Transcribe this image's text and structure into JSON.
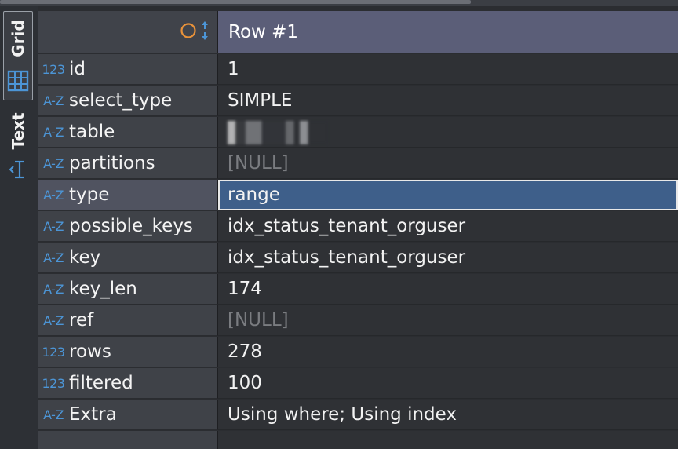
{
  "tabs": {
    "grid_label": "Grid",
    "text_label": "Text"
  },
  "header": {
    "column_title": "Row  #1"
  },
  "colors": {
    "accent_blue": "#4c95d6",
    "header_purple": "#5b5e78",
    "selection_blue": "#3e5f8a",
    "sort_orange": "#e8923a"
  },
  "rows": [
    {
      "type_icon": "123",
      "name": "id",
      "value": "1"
    },
    {
      "type_icon": "A-Z",
      "name": "select_type",
      "value": "SIMPLE"
    },
    {
      "type_icon": "A-Z",
      "name": "table",
      "value": ""
    },
    {
      "type_icon": "A-Z",
      "name": "partitions",
      "value": "[NULL]"
    },
    {
      "type_icon": "A-Z",
      "name": "type",
      "value": "range"
    },
    {
      "type_icon": "A-Z",
      "name": "possible_keys",
      "value": "idx_status_tenant_orguser"
    },
    {
      "type_icon": "A-Z",
      "name": "key",
      "value": "idx_status_tenant_orguser"
    },
    {
      "type_icon": "A-Z",
      "name": "key_len",
      "value": "174"
    },
    {
      "type_icon": "A-Z",
      "name": "ref",
      "value": "[NULL]"
    },
    {
      "type_icon": "123",
      "name": "rows",
      "value": "278"
    },
    {
      "type_icon": "123",
      "name": "filtered",
      "value": "100"
    },
    {
      "type_icon": "A-Z",
      "name": "Extra",
      "value": "Using where; Using index"
    }
  ]
}
